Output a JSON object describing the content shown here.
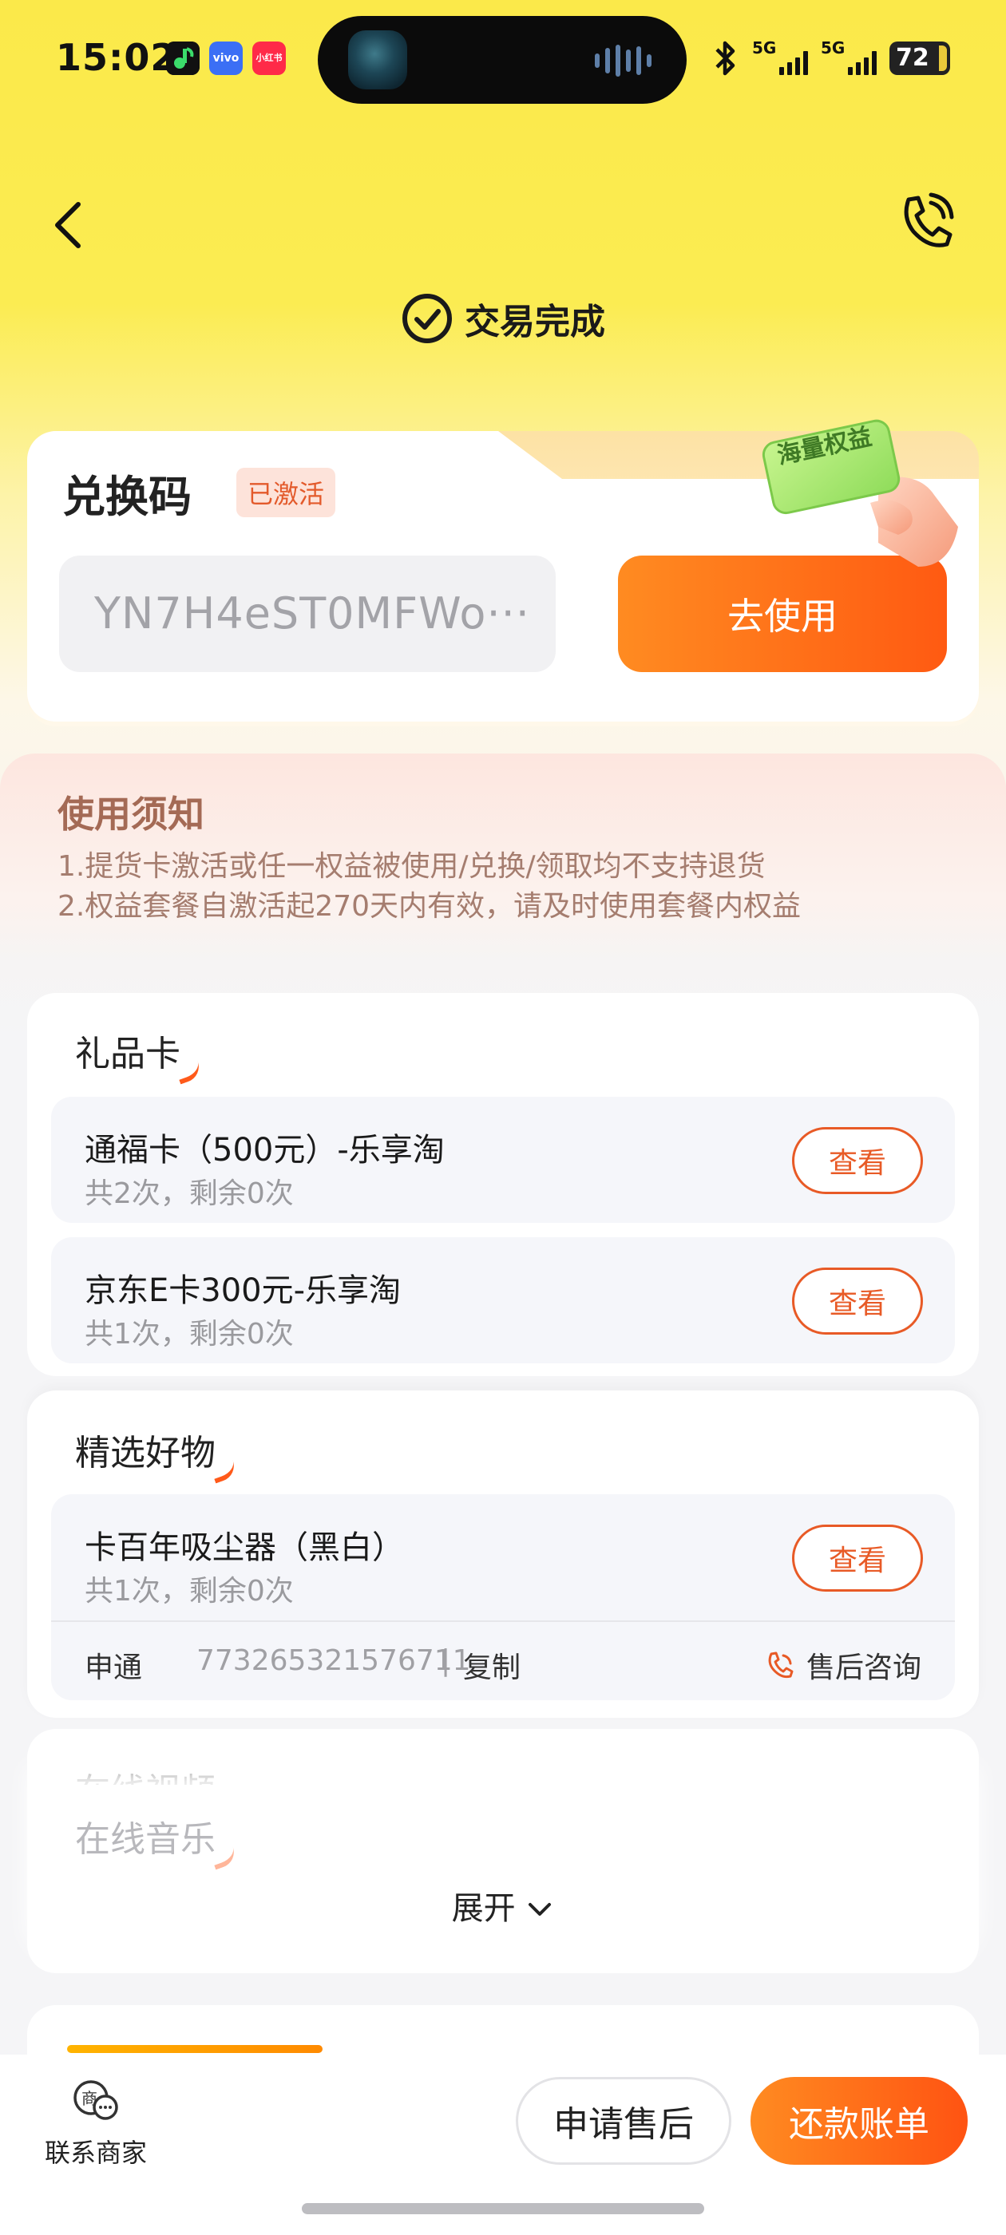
{
  "status": {
    "time": "15:02",
    "apps": [
      "vivo",
      "小红书"
    ],
    "signal_1": "5G",
    "signal_2": "5G",
    "battery": "72"
  },
  "header": {
    "title": "交易完成"
  },
  "redeem": {
    "label": "兑换码",
    "status_badge": "已激活",
    "code": "YN7H4eST0MFWo···",
    "use_button": "去使用",
    "badge_text": "海量权益"
  },
  "notice": {
    "title": "使用须知",
    "lines": [
      "1.提货卡激活或任一权益被使用/兑换/领取均不支持退货",
      "2.权益套餐自激活起270天内有效，请及时使用套餐内权益"
    ]
  },
  "gift_cards": {
    "title": "礼品卡",
    "items": [
      {
        "name": "通福卡（500元）-乐享淘",
        "sub": "共2次，剩余0次",
        "button": "查看"
      },
      {
        "name": "京东E卡300元-乐享淘",
        "sub": "共1次，剩余0次",
        "button": "查看"
      }
    ]
  },
  "goods": {
    "title": "精选好物",
    "items": [
      {
        "name": "卡百年吸尘器（黑白）",
        "sub": "共1次，剩余0次",
        "button": "查看"
      }
    ],
    "shipping": {
      "carrier": "申通",
      "tracking": "773265321576711",
      "separator": "|",
      "copy": "复制",
      "service": "售后咨询"
    }
  },
  "collapsed": {
    "video_title": "在线视频",
    "music_title": "在线音乐",
    "expand_label": "展开"
  },
  "bottom_bar": {
    "contact_label": "联系商家",
    "contact_icon_char": "商",
    "aftersale_button": "申请售后",
    "bill_button": "还款账单"
  },
  "colors": {
    "accent": "#ff5a12",
    "header_yellow": "#fbe94a"
  }
}
